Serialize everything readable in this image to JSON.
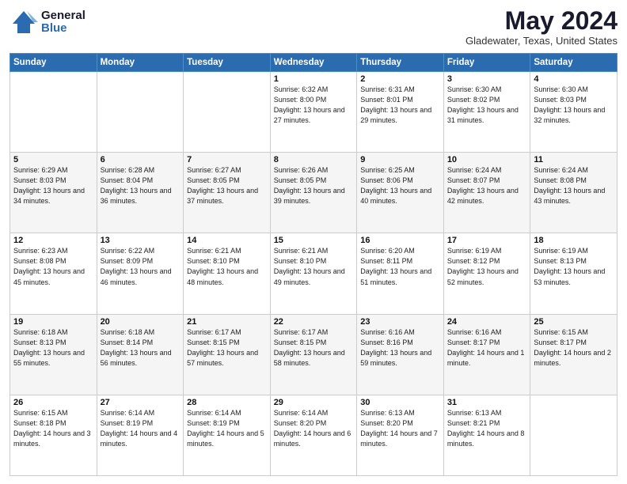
{
  "header": {
    "logo_general": "General",
    "logo_blue": "Blue",
    "title": "May 2024",
    "location": "Gladewater, Texas, United States"
  },
  "days_of_week": [
    "Sunday",
    "Monday",
    "Tuesday",
    "Wednesday",
    "Thursday",
    "Friday",
    "Saturday"
  ],
  "weeks": [
    [
      {
        "day": "",
        "sunrise": "",
        "sunset": "",
        "daylight": ""
      },
      {
        "day": "",
        "sunrise": "",
        "sunset": "",
        "daylight": ""
      },
      {
        "day": "",
        "sunrise": "",
        "sunset": "",
        "daylight": ""
      },
      {
        "day": "1",
        "sunrise": "Sunrise: 6:32 AM",
        "sunset": "Sunset: 8:00 PM",
        "daylight": "Daylight: 13 hours and 27 minutes."
      },
      {
        "day": "2",
        "sunrise": "Sunrise: 6:31 AM",
        "sunset": "Sunset: 8:01 PM",
        "daylight": "Daylight: 13 hours and 29 minutes."
      },
      {
        "day": "3",
        "sunrise": "Sunrise: 6:30 AM",
        "sunset": "Sunset: 8:02 PM",
        "daylight": "Daylight: 13 hours and 31 minutes."
      },
      {
        "day": "4",
        "sunrise": "Sunrise: 6:30 AM",
        "sunset": "Sunset: 8:03 PM",
        "daylight": "Daylight: 13 hours and 32 minutes."
      }
    ],
    [
      {
        "day": "5",
        "sunrise": "Sunrise: 6:29 AM",
        "sunset": "Sunset: 8:03 PM",
        "daylight": "Daylight: 13 hours and 34 minutes."
      },
      {
        "day": "6",
        "sunrise": "Sunrise: 6:28 AM",
        "sunset": "Sunset: 8:04 PM",
        "daylight": "Daylight: 13 hours and 36 minutes."
      },
      {
        "day": "7",
        "sunrise": "Sunrise: 6:27 AM",
        "sunset": "Sunset: 8:05 PM",
        "daylight": "Daylight: 13 hours and 37 minutes."
      },
      {
        "day": "8",
        "sunrise": "Sunrise: 6:26 AM",
        "sunset": "Sunset: 8:05 PM",
        "daylight": "Daylight: 13 hours and 39 minutes."
      },
      {
        "day": "9",
        "sunrise": "Sunrise: 6:25 AM",
        "sunset": "Sunset: 8:06 PM",
        "daylight": "Daylight: 13 hours and 40 minutes."
      },
      {
        "day": "10",
        "sunrise": "Sunrise: 6:24 AM",
        "sunset": "Sunset: 8:07 PM",
        "daylight": "Daylight: 13 hours and 42 minutes."
      },
      {
        "day": "11",
        "sunrise": "Sunrise: 6:24 AM",
        "sunset": "Sunset: 8:08 PM",
        "daylight": "Daylight: 13 hours and 43 minutes."
      }
    ],
    [
      {
        "day": "12",
        "sunrise": "Sunrise: 6:23 AM",
        "sunset": "Sunset: 8:08 PM",
        "daylight": "Daylight: 13 hours and 45 minutes."
      },
      {
        "day": "13",
        "sunrise": "Sunrise: 6:22 AM",
        "sunset": "Sunset: 8:09 PM",
        "daylight": "Daylight: 13 hours and 46 minutes."
      },
      {
        "day": "14",
        "sunrise": "Sunrise: 6:21 AM",
        "sunset": "Sunset: 8:10 PM",
        "daylight": "Daylight: 13 hours and 48 minutes."
      },
      {
        "day": "15",
        "sunrise": "Sunrise: 6:21 AM",
        "sunset": "Sunset: 8:10 PM",
        "daylight": "Daylight: 13 hours and 49 minutes."
      },
      {
        "day": "16",
        "sunrise": "Sunrise: 6:20 AM",
        "sunset": "Sunset: 8:11 PM",
        "daylight": "Daylight: 13 hours and 51 minutes."
      },
      {
        "day": "17",
        "sunrise": "Sunrise: 6:19 AM",
        "sunset": "Sunset: 8:12 PM",
        "daylight": "Daylight: 13 hours and 52 minutes."
      },
      {
        "day": "18",
        "sunrise": "Sunrise: 6:19 AM",
        "sunset": "Sunset: 8:13 PM",
        "daylight": "Daylight: 13 hours and 53 minutes."
      }
    ],
    [
      {
        "day": "19",
        "sunrise": "Sunrise: 6:18 AM",
        "sunset": "Sunset: 8:13 PM",
        "daylight": "Daylight: 13 hours and 55 minutes."
      },
      {
        "day": "20",
        "sunrise": "Sunrise: 6:18 AM",
        "sunset": "Sunset: 8:14 PM",
        "daylight": "Daylight: 13 hours and 56 minutes."
      },
      {
        "day": "21",
        "sunrise": "Sunrise: 6:17 AM",
        "sunset": "Sunset: 8:15 PM",
        "daylight": "Daylight: 13 hours and 57 minutes."
      },
      {
        "day": "22",
        "sunrise": "Sunrise: 6:17 AM",
        "sunset": "Sunset: 8:15 PM",
        "daylight": "Daylight: 13 hours and 58 minutes."
      },
      {
        "day": "23",
        "sunrise": "Sunrise: 6:16 AM",
        "sunset": "Sunset: 8:16 PM",
        "daylight": "Daylight: 13 hours and 59 minutes."
      },
      {
        "day": "24",
        "sunrise": "Sunrise: 6:16 AM",
        "sunset": "Sunset: 8:17 PM",
        "daylight": "Daylight: 14 hours and 1 minute."
      },
      {
        "day": "25",
        "sunrise": "Sunrise: 6:15 AM",
        "sunset": "Sunset: 8:17 PM",
        "daylight": "Daylight: 14 hours and 2 minutes."
      }
    ],
    [
      {
        "day": "26",
        "sunrise": "Sunrise: 6:15 AM",
        "sunset": "Sunset: 8:18 PM",
        "daylight": "Daylight: 14 hours and 3 minutes."
      },
      {
        "day": "27",
        "sunrise": "Sunrise: 6:14 AM",
        "sunset": "Sunset: 8:19 PM",
        "daylight": "Daylight: 14 hours and 4 minutes."
      },
      {
        "day": "28",
        "sunrise": "Sunrise: 6:14 AM",
        "sunset": "Sunset: 8:19 PM",
        "daylight": "Daylight: 14 hours and 5 minutes."
      },
      {
        "day": "29",
        "sunrise": "Sunrise: 6:14 AM",
        "sunset": "Sunset: 8:20 PM",
        "daylight": "Daylight: 14 hours and 6 minutes."
      },
      {
        "day": "30",
        "sunrise": "Sunrise: 6:13 AM",
        "sunset": "Sunset: 8:20 PM",
        "daylight": "Daylight: 14 hours and 7 minutes."
      },
      {
        "day": "31",
        "sunrise": "Sunrise: 6:13 AM",
        "sunset": "Sunset: 8:21 PM",
        "daylight": "Daylight: 14 hours and 8 minutes."
      },
      {
        "day": "",
        "sunrise": "",
        "sunset": "",
        "daylight": ""
      }
    ]
  ]
}
